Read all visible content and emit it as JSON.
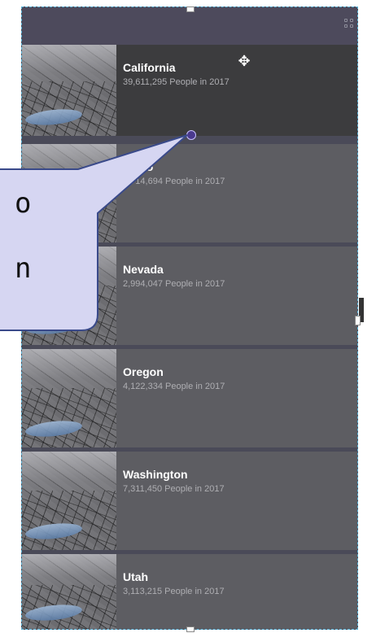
{
  "list": {
    "items": [
      {
        "title": "California",
        "subtitle": "39,611,295  People in 2017",
        "selected": true
      },
      {
        "title": "Idaho",
        "subtitle": "1,714,694  People in 2017",
        "selected": false
      },
      {
        "title": "Nevada",
        "subtitle": "2,994,047  People in 2017",
        "selected": false
      },
      {
        "title": "Oregon",
        "subtitle": "4,122,334  People in 2017",
        "selected": false
      },
      {
        "title": "Washington",
        "subtitle": "7,311,450  People in 2017",
        "selected": false
      },
      {
        "title": "Utah",
        "subtitle": "3,113,215  People in 2017",
        "selected": false
      }
    ]
  },
  "callout": {
    "line1": "o",
    "line2": "n"
  },
  "icons": {
    "grid": "grid-icon",
    "move": "move-icon"
  },
  "colors": {
    "frame_border": "#5cb4d8",
    "callout_fill": "#d6d6f2",
    "callout_border": "#3a4a8a",
    "selected_bg": "#3c3c3e",
    "item_bg": "#5d5d62"
  }
}
